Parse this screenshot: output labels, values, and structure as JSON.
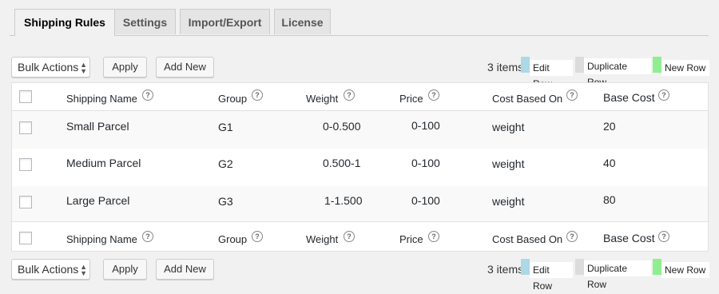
{
  "tabs": [
    {
      "label": "Shipping Rules",
      "active": true
    },
    {
      "label": "Settings"
    },
    {
      "label": "Import/Export"
    },
    {
      "label": "License"
    }
  ],
  "toolbar": {
    "bulk_actions": "Bulk Actions",
    "apply": "Apply",
    "add_new": "Add New",
    "items_count": "3 items",
    "legend": {
      "edit_row": "Edit Row",
      "duplicate_row": "Duplicate Row",
      "new_row": "New Row"
    }
  },
  "colors": {
    "edit_row": "#add8e6",
    "duplicate_row": "#dcdcdc",
    "new_row": "#90ee90"
  },
  "table": {
    "columns": {
      "name": "Shipping Name",
      "group": "Group",
      "weight": "Weight",
      "price": "Price",
      "cost_based_on": "Cost Based On",
      "base_cost": "Base Cost"
    },
    "help_glyph": "?",
    "rows": [
      {
        "name": "Small Parcel",
        "group": "G1",
        "weight": "0-0.500",
        "price": "0-100",
        "cost_based_on": "weight",
        "base_cost": "20"
      },
      {
        "name": "Medium Parcel",
        "group": "G2",
        "weight": "0.500-1",
        "price": "0-100",
        "cost_based_on": "weight",
        "base_cost": "40"
      },
      {
        "name": "Large Parcel",
        "group": "G3",
        "weight": "1-1.500",
        "price": "0-100",
        "cost_based_on": "weight",
        "base_cost": "80"
      }
    ]
  }
}
